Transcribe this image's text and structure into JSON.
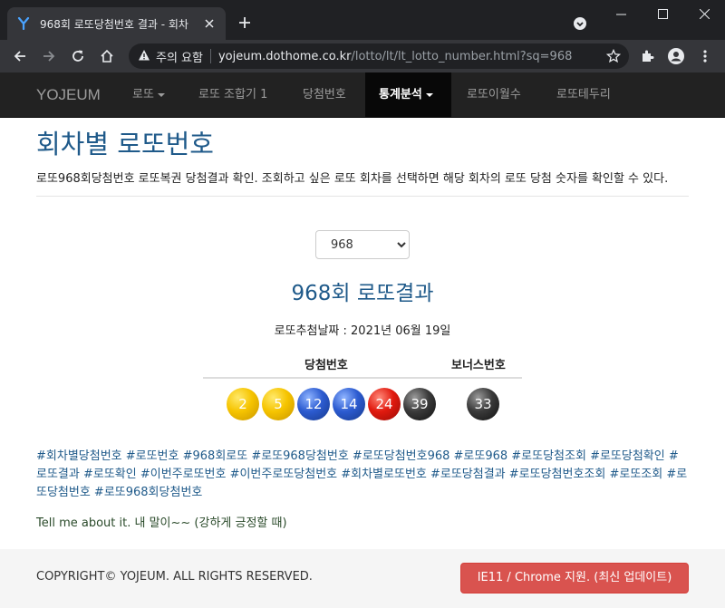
{
  "browser": {
    "tab_title": "968회 로또당첨번호 결과 - 회차",
    "security_label": "주의 요함",
    "url_host": "yojeum.dothome.co.kr",
    "url_path": "/lotto/lt/lt_lotto_number.html?sq=968",
    "icons": [
      "yojeum-favicon-icon",
      "close-icon",
      "plus-icon",
      "tab-search-icon",
      "minimize-icon",
      "maximize-icon",
      "window-close-icon",
      "back-icon",
      "forward-icon",
      "reload-icon",
      "home-icon",
      "warning-icon",
      "star-icon",
      "extensions-icon",
      "profile-icon",
      "menu-icon"
    ]
  },
  "navbar": {
    "brand": "YOJEUM",
    "items": [
      {
        "label": "로또",
        "dropdown": true
      },
      {
        "label": "로또 조합기 1",
        "dropdown": false
      },
      {
        "label": "당첨번호",
        "dropdown": false
      },
      {
        "label": "통계분석",
        "dropdown": true,
        "active": true
      },
      {
        "label": "로또이월수",
        "dropdown": false
      },
      {
        "label": "로또테두리",
        "dropdown": false
      }
    ]
  },
  "page": {
    "title": "회차별 로또번호",
    "description": "로또968회당첨번호 로또복권 당첨결과 확인. 조회하고 싶은 로또 회차를 선택하면 해당 회차의 로또 당첨 숫자를 확인할 수 있다.",
    "round_select_value": "968",
    "result_title": "968회 로또결과",
    "draw_date_label": "로또추첨날짜 : ",
    "draw_date_value": "2021년 06월 19일",
    "winning_header": "당첨번호",
    "bonus_header": "보너스번호",
    "winning_numbers": [
      {
        "n": "2",
        "color": "#f6c400"
      },
      {
        "n": "5",
        "color": "#f6c400"
      },
      {
        "n": "12",
        "color": "#2c5bd0"
      },
      {
        "n": "14",
        "color": "#2c5bd0"
      },
      {
        "n": "24",
        "color": "#e11a0f"
      },
      {
        "n": "39",
        "color": "#3a3a3a"
      }
    ],
    "bonus_number": {
      "n": "33",
      "color": "#3a3a3a"
    },
    "hashtags": "#회차별당첨번호 #로또번호 #968회로또 #로또968당첨번호 #로또당첨번호968 #로또968 #로또당첨조회 #로또당첨확인 #로또결과 #로또확인 #이번주로또번호 #이번주로또당첨번호 #회차별로또번호 #로또당첨결과 #로또당첨번호조회 #로또조회 #로또당첨번호 #로또968회당첨번호",
    "note": "Tell me about it. 내 말이~~ (강하게 긍정할 때)"
  },
  "footer": {
    "copyright": "COPYRIGHT© YOJEUM. ALL RIGHTS RESERVED.",
    "ie_button": "IE11 / Chrome 지원. (최신 업데이트)"
  }
}
